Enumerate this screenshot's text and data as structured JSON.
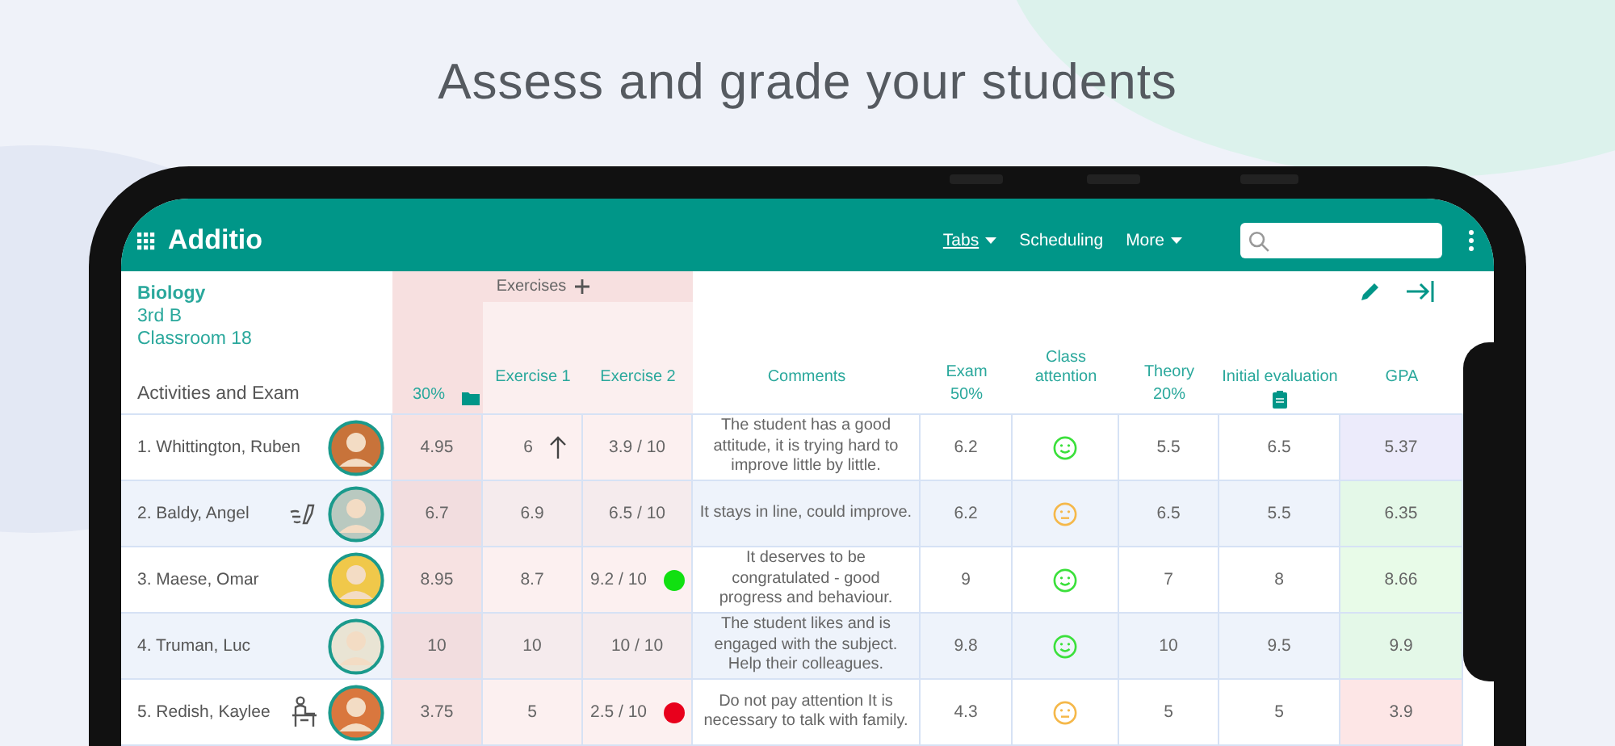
{
  "headline": "Assess and grade your students",
  "app": {
    "logo": "Additio",
    "nav": [
      {
        "label": "Tabs",
        "selected": true,
        "dropdown": true
      },
      {
        "label": "Scheduling",
        "selected": false,
        "dropdown": false
      },
      {
        "label": "More",
        "selected": false,
        "dropdown": true
      }
    ]
  },
  "class_info": {
    "subject": "Biology",
    "group": "3rd B",
    "room": "Classroom 18",
    "title": "Activities and Exam"
  },
  "group_header": "Exercises",
  "columns": [
    {
      "kind": "category",
      "weight": "30%"
    },
    {
      "kind": "plain",
      "label": "Exercise 1"
    },
    {
      "kind": "plain",
      "label": "Exercise 2"
    },
    {
      "kind": "plain",
      "label": "Comments"
    },
    {
      "kind": "weighted",
      "label": "Exam",
      "weight": "50%"
    },
    {
      "kind": "plain",
      "label": "Class attention"
    },
    {
      "kind": "weighted",
      "label": "Theory",
      "weight": "20%"
    },
    {
      "kind": "note",
      "label": "Initial evaluation"
    },
    {
      "kind": "plain",
      "label": "GPA"
    }
  ],
  "rows": [
    {
      "name": "1. Whittington, Ruben",
      "avatar": {
        "color": "#c8733a"
      },
      "category": "4.95",
      "exercise_1": {
        "value": "6",
        "rising": true
      },
      "exercise_2": {
        "value": "3.9 / 10"
      },
      "comment": "The student has a good attitude, it is trying hard to improve little by little.",
      "exam": "6.2",
      "attention": {
        "happy": true
      },
      "theory": "5.5",
      "initial": "6.5",
      "gpa": {
        "value": "5.37",
        "color": "#ecebfb"
      }
    },
    {
      "name": "2. Baldy, Angel",
      "aid": {
        "kind": "inhaler"
      },
      "avatar": {
        "color": "#b9c9c0"
      },
      "category": "6.7",
      "exercise_1": {
        "value": "6.9"
      },
      "exercise_2": {
        "value": "6.5 / 10"
      },
      "comment": "It stays in line, could improve.",
      "exam": "6.2",
      "attention": {
        "happy": false
      },
      "theory": "6.5",
      "initial": "5.5",
      "gpa": {
        "value": "6.35",
        "color": "#e4f8e8"
      }
    },
    {
      "name": "3. Maese, Omar",
      "avatar": {
        "color": "#f0c84a"
      },
      "category": "8.95",
      "exercise_1": {
        "value": "8.7"
      },
      "exercise_2": {
        "value": "9.2 / 10",
        "color": "#11e011"
      },
      "comment": "It deserves to be congratulated - good progress and behaviour.",
      "exam": "9",
      "attention": {
        "happy": true
      },
      "theory": "7",
      "initial": "8",
      "gpa": {
        "value": "8.66",
        "color": "#e8fbe8"
      }
    },
    {
      "name": "4. Truman, Luc",
      "avatar": {
        "color": "#e9e4d4"
      },
      "category": "10",
      "exercise_1": {
        "value": "10"
      },
      "exercise_2": {
        "value": "10 / 10"
      },
      "comment": "The student likes and is engaged with the subject. Help their colleagues.",
      "exam": "9.8",
      "attention": {
        "happy": true
      },
      "theory": "10",
      "initial": "9.5",
      "gpa": {
        "value": "9.9",
        "color": "#e4f8e8"
      }
    },
    {
      "name": "5. Redish, Kaylee",
      "aid": {
        "kind": "desk"
      },
      "avatar": {
        "color": "#d9773e"
      },
      "category": "3.75",
      "exercise_1": {
        "value": "5"
      },
      "exercise_2": {
        "value": "2.5 / 10",
        "color": "#e8001c"
      },
      "comment": "Do not pay attention It is necessary to talk with family.",
      "exam": "4.3",
      "attention": {
        "happy": false
      },
      "theory": "5",
      "initial": "5",
      "gpa": {
        "value": "3.9",
        "color": "#fde6e6"
      }
    }
  ]
}
